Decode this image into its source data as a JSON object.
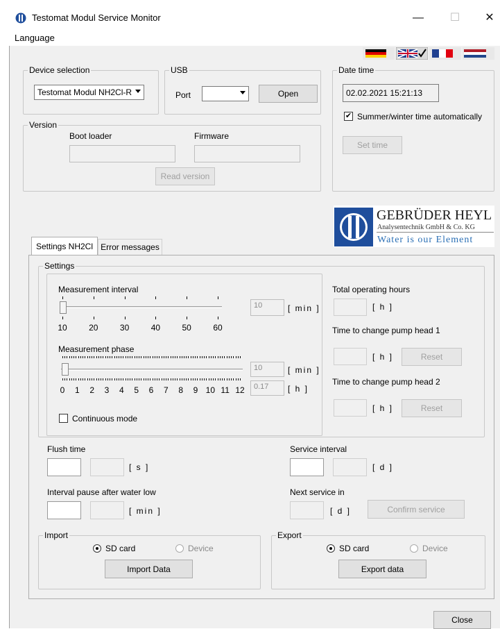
{
  "window": {
    "title": "Testomat Modul Service Monitor",
    "minimize_glyph": "—",
    "maximize_glyph": "☐",
    "close_glyph": "✕"
  },
  "menu": {
    "language": "Language"
  },
  "flags": [
    "german-flag",
    "uk-flag-selected",
    "french-flag",
    "dutch-flag"
  ],
  "device_selection": {
    "title": "Device selection",
    "value": "Testomat Modul NH2Cl-R"
  },
  "usb": {
    "title": "USB",
    "port_label": "Port",
    "port_value": "",
    "open_button": "Open"
  },
  "datetime": {
    "title": "Date time",
    "value": "02.02.2021   15:21:13",
    "summer_winter_label": "Summer/winter time automatically",
    "summer_winter_checked": true,
    "set_time_button": "Set time"
  },
  "version": {
    "title": "Version",
    "boot_loader_label": "Boot loader",
    "firmware_label": "Firmware",
    "read_version_button": "Read version"
  },
  "logo": {
    "company": "GEBRÜDER HEYL",
    "subtitle": "Analysentechnik GmbH & Co. KG",
    "slogan": "Water is our Element"
  },
  "tabs": [
    {
      "label": "Settings NH2Cl",
      "active": true
    },
    {
      "label": "Error messages",
      "active": false
    }
  ],
  "settings": {
    "title": "Settings",
    "measurement_interval": {
      "label": "Measurement interval",
      "ticks": [
        "10",
        "20",
        "30",
        "40",
        "50",
        "60"
      ],
      "value": "10",
      "unit": "[ min ]"
    },
    "measurement_phase": {
      "label": "Measurement phase",
      "ticks": [
        "0",
        "1",
        "2",
        "3",
        "4",
        "5",
        "6",
        "7",
        "8",
        "9",
        "10",
        "11",
        "12"
      ],
      "value_min": "10",
      "unit_min": "[ min ]",
      "value_h": "0.17",
      "unit_h": "[ h ]"
    },
    "continuous_mode_label": "Continuous mode",
    "continuous_mode_checked": false,
    "total_hours_label": "Total operating hours",
    "total_hours_unit": "[ h ]",
    "pump1_label": "Time to change pump head 1",
    "pump1_unit": "[ h ]",
    "pump2_label": "Time to change pump head 2",
    "pump2_unit": "[ h ]",
    "reset_button": "Reset"
  },
  "flush": {
    "label": "Flush time",
    "unit": "[ s ]"
  },
  "interval_pause": {
    "label": "Interval pause after water low",
    "unit": "[ min ]"
  },
  "service_interval": {
    "label": "Service interval",
    "unit": "[ d ]"
  },
  "next_service": {
    "label": "Next service in",
    "unit": "[ d ]",
    "confirm_button": "Confirm service"
  },
  "import": {
    "title": "Import",
    "sd_card": "SD card",
    "device": "Device",
    "button": "Import Data"
  },
  "export": {
    "title": "Export",
    "sd_card": "SD card",
    "device": "Device",
    "button": "Export data"
  },
  "close_button": "Close"
}
